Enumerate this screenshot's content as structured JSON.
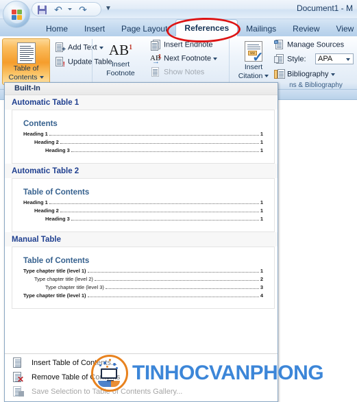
{
  "window": {
    "title": "Document1 - M",
    "office_button": "office-orb"
  },
  "quick_access": {
    "save": "Save",
    "undo": "Undo",
    "redo": "Redo",
    "customize": "Customize Quick Access Toolbar"
  },
  "tabs": [
    {
      "label": "Home",
      "active": false
    },
    {
      "label": "Insert",
      "active": false
    },
    {
      "label": "Page Layout",
      "active": false
    },
    {
      "label": "References",
      "active": true
    },
    {
      "label": "Mailings",
      "active": false
    },
    {
      "label": "Review",
      "active": false
    },
    {
      "label": "View",
      "active": false
    }
  ],
  "ribbon": {
    "groups": [
      {
        "name": "table-of-contents",
        "label": "",
        "big_button": {
          "line1": "Table of",
          "line2": "Contents"
        },
        "commands": [
          {
            "label": "Add Text",
            "has_caret": true,
            "disabled": false
          },
          {
            "label": "Update Table",
            "has_caret": false,
            "disabled": false
          }
        ]
      },
      {
        "name": "footnotes",
        "label": "",
        "big_button": {
          "glyph": "AB",
          "sup": "1",
          "line1": "Insert",
          "line2": "Footnote"
        },
        "commands": [
          {
            "label": "Insert Endnote",
            "has_caret": false,
            "disabled": false
          },
          {
            "label": "Next Footnote",
            "has_caret": true,
            "disabled": false
          },
          {
            "label": "Show Notes",
            "has_caret": false,
            "disabled": true
          }
        ]
      },
      {
        "name": "citations-bibliography",
        "label": "ns & Bibliography",
        "big_button": {
          "line1": "Insert",
          "line2": "Citation"
        },
        "commands": [
          {
            "label": "Manage Sources",
            "has_caret": false,
            "disabled": false
          },
          {
            "label": "Style:",
            "has_caret": false,
            "disabled": false
          },
          {
            "label": "Bibliography",
            "has_caret": true,
            "disabled": false
          }
        ],
        "style_value": "APA"
      }
    ]
  },
  "gallery": {
    "header": "Built-In",
    "items": [
      {
        "title": "Automatic Table 1",
        "preview_heading": "Contents",
        "lines": [
          {
            "text": "Heading 1",
            "level": 1,
            "page": "1"
          },
          {
            "text": "Heading 2",
            "level": 2,
            "page": "1"
          },
          {
            "text": "Heading 3",
            "level": 3,
            "page": "1"
          }
        ]
      },
      {
        "title": "Automatic Table 2",
        "preview_heading": "Table of Contents",
        "lines": [
          {
            "text": "Heading 1",
            "level": 1,
            "page": "1"
          },
          {
            "text": "Heading 2",
            "level": 2,
            "page": "1"
          },
          {
            "text": "Heading 3",
            "level": 3,
            "page": "1"
          }
        ]
      },
      {
        "title": "Manual Table",
        "preview_heading": "Table of Contents",
        "lines": [
          {
            "text": "Type chapter title (level 1)",
            "level": 1,
            "page": "1"
          },
          {
            "text": "Type chapter title (level 2)",
            "level": 2,
            "page": "2"
          },
          {
            "text": "Type chapter title (level 3)",
            "level": 3,
            "page": "3"
          },
          {
            "text": "Type chapter title (level 1)",
            "level": 1,
            "page": "4"
          }
        ]
      }
    ],
    "menu": [
      {
        "label": "Insert Table of Contents...",
        "accel": "I",
        "disabled": false,
        "icon": "toc-document-icon"
      },
      {
        "label": "Remove Table of Contents",
        "accel": "R",
        "disabled": false,
        "icon": "toc-remove-icon"
      },
      {
        "label": "Save Selection to Table of Contents Gallery...",
        "accel": "S",
        "disabled": true,
        "icon": "toc-save-icon"
      }
    ]
  },
  "annotation": {
    "shape": "ellipse",
    "color": "#dd1414",
    "targets": "References"
  },
  "watermark": {
    "text": "TINHOCVANPHONG",
    "color": "#3c86d8",
    "logo": "tinhocvanphong-logo"
  }
}
